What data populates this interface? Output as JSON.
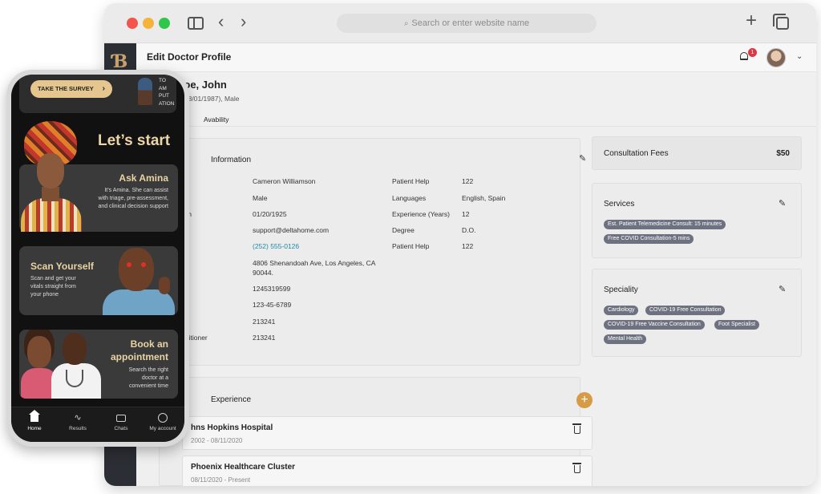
{
  "browser": {
    "url_placeholder": "Search or enter website name"
  },
  "header": {
    "title": "Edit Doctor Profile",
    "notification_count": "1"
  },
  "profile": {
    "name": "Doe, John",
    "meta": "o.(08/01/1987), Male",
    "tab_availability": "Avability"
  },
  "information": {
    "title": "Information",
    "left_labels": [
      "rth",
      "ctitioner"
    ],
    "left_values": [
      "Cameron Williamson",
      "Male",
      "01/20/1925",
      "support@deltahome.com",
      "(252) 555-0126",
      "4806 Shenandoah Ave, Los Angeles, CA",
      "90044.",
      "1245319599",
      "123-45-6789",
      "213241",
      "213241"
    ],
    "right_labels": [
      "Patient Help",
      "Languages",
      "Experience (Years)",
      "Degree",
      "Patient Help"
    ],
    "right_values": [
      "122",
      "English, Spain",
      "12",
      "D.O.",
      "122"
    ]
  },
  "fees": {
    "label": "Consultation Fees",
    "value": "$50"
  },
  "services": {
    "title": "Services",
    "chips": [
      "Est. Patient Telemedicine Consult: 15 minutes",
      "Free COVID Consultation-5 mins"
    ]
  },
  "speciality": {
    "title": "Speciality",
    "chips": [
      "Cardiology",
      "COVID-19 Free Consultation",
      "COVID-19 Free Vaccine Consultation",
      "Foot Specialist",
      "Mental Health"
    ]
  },
  "experience": {
    "title": "Experience",
    "items": [
      {
        "name": "hns Hopkins Hospital",
        "dates": "2002 - 08/11/2020"
      },
      {
        "name": "Phoenix Healthcare Cluster",
        "dates": "08/11/2020 - Present"
      }
    ]
  },
  "phone": {
    "survey_button": "TAKE THE SURVEY",
    "survey_text": [
      "TO",
      "AM",
      "PUT",
      "ATION"
    ],
    "headline": "Let’s start",
    "cards": [
      {
        "title": "Ask Amina",
        "desc": [
          "It’s Amina. She can assist",
          "with triage, pre-assessment,",
          "and clinical decision support"
        ]
      },
      {
        "title": "Scan Yourself",
        "desc": [
          "Scan and get your",
          "vitals straight from",
          "your phone"
        ]
      },
      {
        "title": "Book an",
        "title2": "appointment",
        "desc": [
          "Search the right",
          "doctor at a",
          "convenient time"
        ]
      }
    ],
    "tabs": [
      "Home",
      "Results",
      "Chats",
      "My account"
    ]
  },
  "colors": {
    "accent": "#d79b46",
    "phone_gold": "#e9d3a4",
    "chip": "#6e7280",
    "link": "#1f8aa3",
    "badge": "#e03545"
  }
}
